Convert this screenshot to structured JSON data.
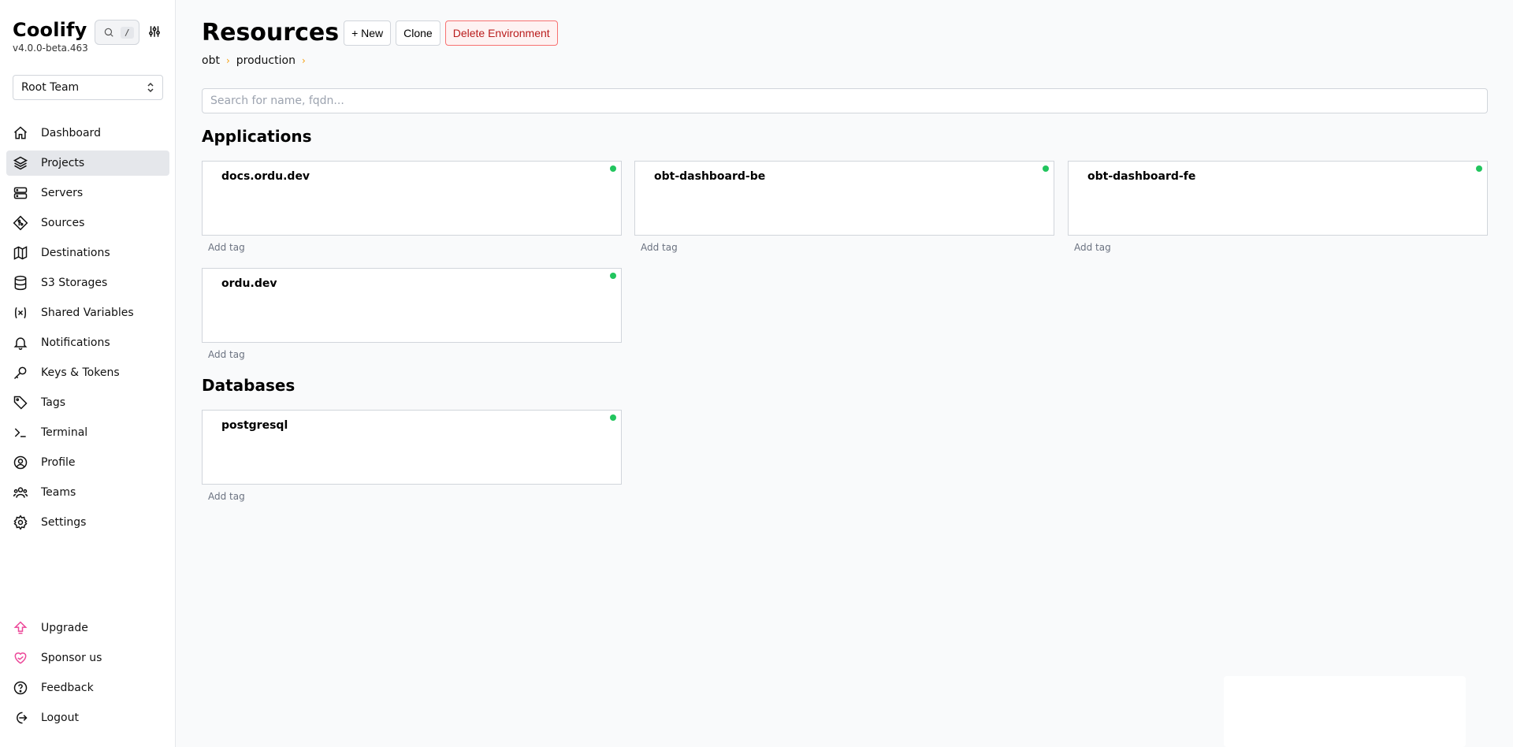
{
  "brand": {
    "name": "Coolify",
    "version": "v4.0.0-beta.463"
  },
  "search_shortcut": "/",
  "team_select": {
    "value": "Root Team"
  },
  "nav": {
    "items": [
      {
        "label": "Dashboard",
        "icon": "home-icon"
      },
      {
        "label": "Projects",
        "icon": "layers-icon",
        "active": true
      },
      {
        "label": "Servers",
        "icon": "server-icon"
      },
      {
        "label": "Sources",
        "icon": "git-icon"
      },
      {
        "label": "Destinations",
        "icon": "map-icon"
      },
      {
        "label": "S3 Storages",
        "icon": "database-icon"
      },
      {
        "label": "Shared Variables",
        "icon": "variable-icon"
      },
      {
        "label": "Notifications",
        "icon": "bell-icon"
      },
      {
        "label": "Keys & Tokens",
        "icon": "key-icon"
      },
      {
        "label": "Tags",
        "icon": "tag-icon"
      },
      {
        "label": "Terminal",
        "icon": "terminal-icon"
      },
      {
        "label": "Profile",
        "icon": "user-circle-icon"
      },
      {
        "label": "Teams",
        "icon": "users-icon"
      },
      {
        "label": "Settings",
        "icon": "gear-icon"
      }
    ],
    "bottom": [
      {
        "label": "Upgrade",
        "icon": "upgrade-icon"
      },
      {
        "label": "Sponsor us",
        "icon": "heart-icon"
      },
      {
        "label": "Feedback",
        "icon": "help-icon"
      },
      {
        "label": "Logout",
        "icon": "logout-icon"
      }
    ]
  },
  "header": {
    "title": "Resources",
    "new_label": "+ New",
    "clone_label": "Clone",
    "delete_label": "Delete Environment"
  },
  "breadcrumb": [
    "obt",
    "production"
  ],
  "search": {
    "placeholder": "Search for name, fqdn..."
  },
  "sections": {
    "applications": {
      "title": "Applications",
      "items": [
        {
          "name": "docs.ordu.dev",
          "tag_label": "Add tag",
          "status": "running"
        },
        {
          "name": "obt-dashboard-be",
          "tag_label": "Add tag",
          "status": "running"
        },
        {
          "name": "obt-dashboard-fe",
          "tag_label": "Add tag",
          "status": "running"
        },
        {
          "name": "ordu.dev",
          "tag_label": "Add tag",
          "status": "running"
        }
      ]
    },
    "databases": {
      "title": "Databases",
      "items": [
        {
          "name": "postgresql",
          "tag_label": "Add tag",
          "status": "running"
        }
      ]
    }
  },
  "colors": {
    "status_running": "#22c55e",
    "danger": "#b91c1c",
    "breadcrumb_chevron": "#f59e0b",
    "sponsor": "#ec4899"
  }
}
